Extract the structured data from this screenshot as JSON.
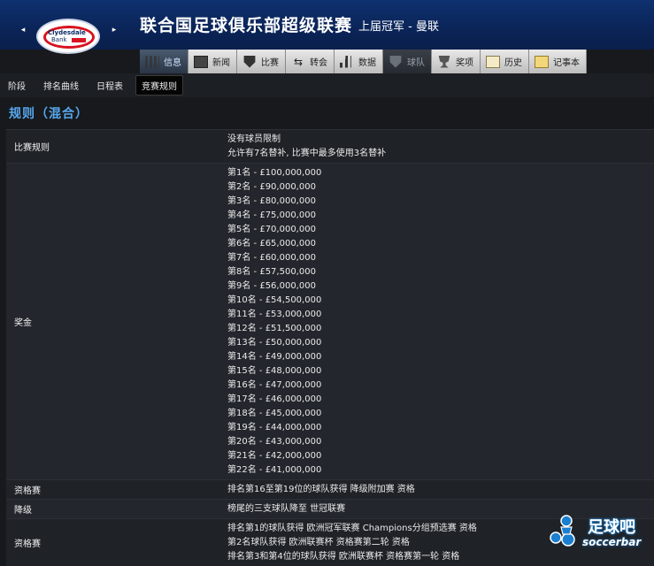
{
  "header": {
    "title": "联合国足球俱乐部超级联赛",
    "subtitle": "上届冠军 - 曼联",
    "logo_text_1": "Clydesdale",
    "logo_text_2": "Bank",
    "prev_arrow": "◂",
    "next_arrow": "▸"
  },
  "tabs": [
    {
      "label": "信息",
      "icon": "grid-icon",
      "state": "active"
    },
    {
      "label": "新闻",
      "icon": "news-icon",
      "state": "normal"
    },
    {
      "label": "比赛",
      "icon": "shield-icon",
      "state": "normal"
    },
    {
      "label": "转会",
      "icon": "arrows-icon",
      "state": "normal"
    },
    {
      "label": "数据",
      "icon": "bar-chart-icon",
      "state": "normal"
    },
    {
      "label": "球队",
      "icon": "shield-icon",
      "state": "disabled"
    },
    {
      "label": "奖项",
      "icon": "trophy-icon",
      "state": "normal"
    },
    {
      "label": "历史",
      "icon": "document-icon",
      "state": "normal"
    },
    {
      "label": "记事本",
      "icon": "notepad-icon",
      "state": "normal"
    }
  ],
  "subnav": [
    "阶段",
    "排名曲线",
    "日程表",
    "竞赛规则"
  ],
  "subnav_active": "竞赛规则",
  "section_title": "规则（混合）",
  "rules": [
    {
      "label": "比赛规则",
      "values": [
        "没有球员限制",
        "允许有7名替补, 比赛中最多使用3名替补"
      ]
    },
    {
      "label": "奖金",
      "values": [
        "第1名 - £100,000,000",
        "第2名 - £90,000,000",
        "第3名 - £80,000,000",
        "第4名 - £75,000,000",
        "第5名 - £70,000,000",
        "第6名 - £65,000,000",
        "第7名 - £60,000,000",
        "第8名 - £57,500,000",
        "第9名 - £56,000,000",
        "第10名 - £54,500,000",
        "第11名 - £53,000,000",
        "第12名 - £51,500,000",
        "第13名 - £50,000,000",
        "第14名 - £49,000,000",
        "第15名 - £48,000,000",
        "第16名 - £47,000,000",
        "第17名 - £46,000,000",
        "第18名 - £45,000,000",
        "第19名 - £44,000,000",
        "第20名 - £43,000,000",
        "第21名 - £42,000,000",
        "第22名 - £41,000,000"
      ]
    },
    {
      "label": "资格赛",
      "values": [
        "排名第16至第19位的球队获得 降级附加赛 资格"
      ]
    },
    {
      "label": "降级",
      "values": [
        "榜尾的三支球队降至 世冠联赛"
      ]
    },
    {
      "label": "资格赛",
      "values": [
        "排名第1的球队获得 欧洲冠军联赛 Champions分组预选赛 资格",
        "第2名球队获得 欧洲联赛杯 资格赛第二轮 资格",
        "排名第3和第4位的球队获得 欧洲联赛杯 资格赛第一轮 资格"
      ]
    }
  ],
  "watermark": {
    "text_cn": "足球吧",
    "text_en": "soccerbar"
  },
  "colors": {
    "header_bg": "#0a2457",
    "section_title": "#58a8ee",
    "page_bg": "#17191c",
    "logo_red": "#d8131f"
  }
}
